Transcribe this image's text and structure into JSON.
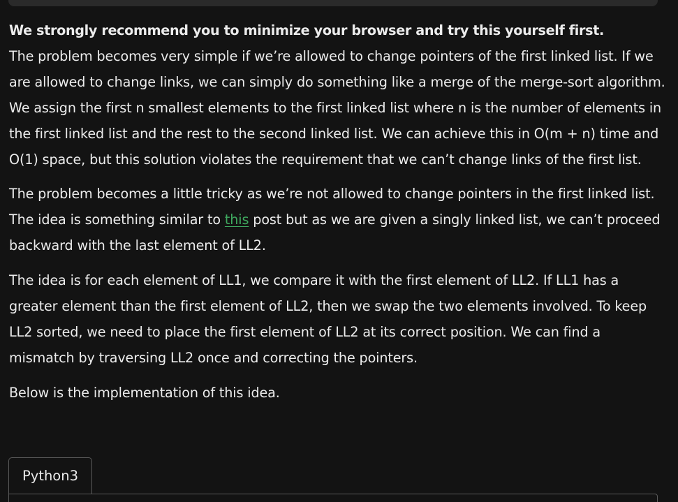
{
  "article": {
    "strong_line": "We strongly recommend you to minimize your browser and try this yourself first.",
    "para1": "The problem becomes very simple if we’re allowed to change pointers of the first linked list. If we are allowed to change links, we can simply do something like a merge of the merge-sort algorithm. We assign the first n smallest elements to the first linked list where n is the number of elements in the first linked list and the rest to the second linked list. We can achieve this in O(m + n) time and O(1) space, but this solution violates the requirement that we can’t change links of the first list.",
    "para2_before": "The problem becomes a little tricky as we’re not allowed to change pointers in the first linked list. The idea is something similar to ",
    "para2_link": "this",
    "para2_after": " post but as we are given a singly linked list, we can’t proceed backward with the last element of LL2.",
    "para3": "The idea is for each element of LL1, we compare it with the first element of LL2. If LL1 has a greater element than the first element of LL2, then we swap the two elements involved. To keep LL2 sorted, we need to place the first element of LL2 at its correct position. We can find a mismatch by traversing LL2 once and correcting the pointers.",
    "para4": "Below is the implementation of this idea."
  },
  "code": {
    "tab_label": "Python3"
  },
  "colors": {
    "background": "#131313",
    "text": "#ececec",
    "link": "#3fa95f",
    "border": "#5a5a5a"
  }
}
